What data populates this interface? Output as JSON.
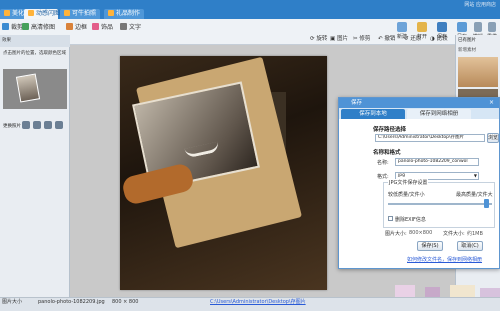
{
  "window": {
    "title": "网站 应用商店"
  },
  "tabs": [
    {
      "label": "美化编辑",
      "active": false
    },
    {
      "label": "动感闪图",
      "active": true
    },
    {
      "label": "可牛拍照",
      "active": false
    },
    {
      "label": "礼品制作",
      "active": false
    }
  ],
  "toolbar": {
    "items": [
      "裁剪",
      "高清修图",
      "边框",
      "饰品",
      "文字"
    ],
    "right_buttons": [
      "新建",
      "打开",
      "保存",
      "另存",
      "撤销",
      "重做"
    ]
  },
  "strip": [
    "旋转",
    "图片",
    "修剪",
    "撤销",
    "还原",
    "比较"
  ],
  "left_panel": {
    "header": "效果",
    "hint": "点击图片的位置，选取颜色区域",
    "footer": "更换照片"
  },
  "right_panel": {
    "header": "已有图片",
    "label": "新增素材",
    "sub": "添加"
  },
  "status": {
    "items": [
      "图片大小",
      "panolo-photo-1082209.jpg",
      "800 × 800"
    ],
    "path": "C:\\Users\\Administrator\\Desktop\\存图片"
  },
  "dialog": {
    "title": "保存",
    "tab_primary": "保存到本地",
    "tab_secondary": "保存到网络相册",
    "section_path": "保存路径选择",
    "path_value": "C:\\Users\\Administrator\\Desktop\\存图片",
    "browse_label": "浏览",
    "section_name": "名称和格式",
    "name_label": "名称:",
    "name_value": "panolo-photo-1082209_conwol",
    "format_label": "格式:",
    "format_value": "jpg",
    "quality_group": "JPG文件保存设置",
    "min_label": "较低质量/文件小",
    "max_label": "最高质量/文件大",
    "strip_exif_label": "删除EXIF信息",
    "size_label": "图片大小:",
    "size_value": "800×800",
    "filesize_label": "文件大小:",
    "filesize_value": "约1MB",
    "save_button": "保存(S)",
    "cancel_button": "取消(C)",
    "link": "如何修改文件名，保存到网络相册"
  },
  "colors": {
    "accent": "#2f7fc8",
    "dialog_border": "#5e96cf",
    "link": "#2a5bd7"
  }
}
